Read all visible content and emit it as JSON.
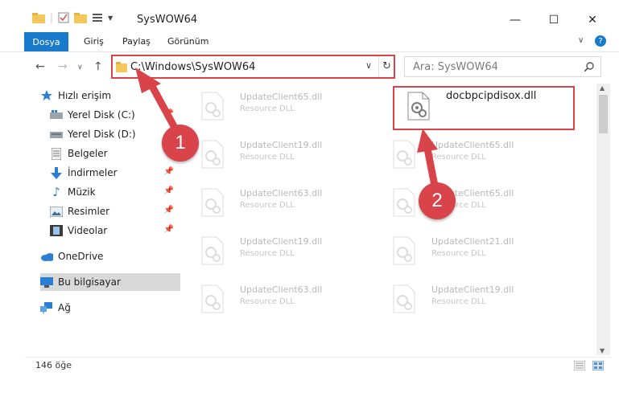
{
  "window": {
    "title": "SysWOW64"
  },
  "ribbon": {
    "tabs": [
      "Dosya",
      "Giriş",
      "Paylaş",
      "Görünüm"
    ]
  },
  "address": {
    "path": "C:\\Windows\\SysWOW64"
  },
  "search": {
    "placeholder": "Ara: SysWOW64"
  },
  "sidebar": {
    "items": [
      {
        "label": "Hızlı erişim",
        "icon": "star-icon"
      },
      {
        "label": "Yerel Disk (C:)",
        "icon": "drive-icon",
        "pinned": true
      },
      {
        "label": "Yerel Disk (D:)",
        "icon": "drive-icon"
      },
      {
        "label": "Belgeler",
        "icon": "document-icon"
      },
      {
        "label": "İndirmeler",
        "icon": "download-icon",
        "pinned": true
      },
      {
        "label": "Müzik",
        "icon": "music-icon",
        "pinned": true
      },
      {
        "label": "Resimler",
        "icon": "picture-icon",
        "pinned": true
      },
      {
        "label": "Videolar",
        "icon": "video-icon",
        "pinned": true
      },
      {
        "label": "OneDrive",
        "icon": "cloud-icon"
      },
      {
        "label": "Bu bilgisayar",
        "icon": "computer-icon",
        "selected": true
      },
      {
        "label": "Ağ",
        "icon": "network-icon"
      }
    ]
  },
  "files": [
    {
      "name": "UpdateClient65.dll",
      "type": "Resource DLL"
    },
    {
      "name": "docbpcipdisox.dll",
      "type": ""
    },
    {
      "name": "UpdateClient19.dll",
      "type": "Resource DLL"
    },
    {
      "name": "UpdateClient65.dll",
      "type": "Resource DLL"
    },
    {
      "name": "UpdateClient63.dll",
      "type": "Resource DLL"
    },
    {
      "name": "UpdateClient65.dll",
      "type": "Resource DLL"
    },
    {
      "name": "UpdateClient19.dll",
      "type": "Resource DLL"
    },
    {
      "name": "UpdateClient21.dll",
      "type": "Resource DLL"
    },
    {
      "name": "UpdateClient63.dll",
      "type": "Resource DLL"
    },
    {
      "name": "UpdateClient19.dll",
      "type": "Resource DLL"
    }
  ],
  "status": {
    "count": "146 öğe"
  },
  "annotations": {
    "step1": "1",
    "step2": "2"
  },
  "colors": {
    "accent": "#1979ca",
    "highlight": "#d9434a"
  }
}
